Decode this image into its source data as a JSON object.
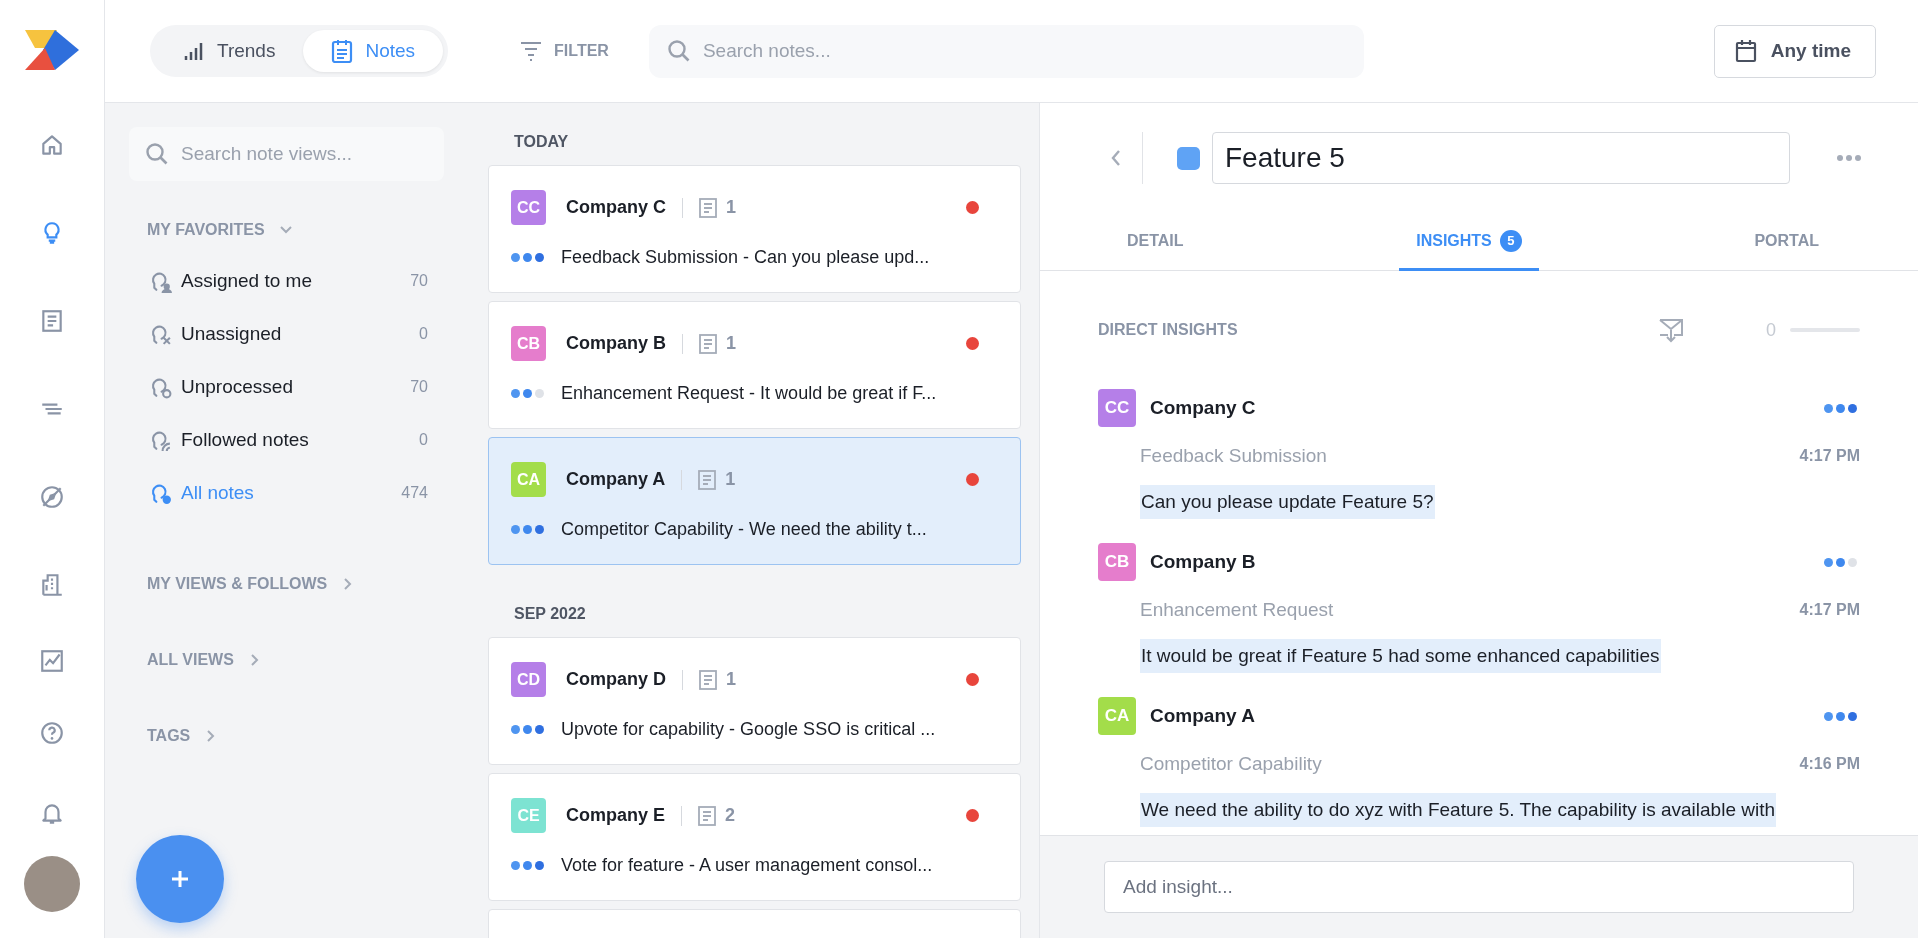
{
  "rail": {
    "items": [
      {
        "kind": "home",
        "selected": false
      },
      {
        "kind": "bulb",
        "selected": true
      },
      {
        "kind": "doc",
        "selected": false
      },
      {
        "kind": "lines",
        "selected": false
      },
      {
        "kind": "compass",
        "selected": false
      },
      {
        "kind": "building",
        "selected": false
      },
      {
        "kind": "chart",
        "selected": false
      },
      {
        "kind": "help",
        "selected": false
      },
      {
        "kind": "bell",
        "selected": false
      }
    ]
  },
  "top_bar": {
    "view_tabs": [
      {
        "kind": "trends",
        "label": "Trends",
        "selected": false
      },
      {
        "kind": "notes",
        "label": "Notes",
        "selected": true
      }
    ],
    "filter": "FILTER",
    "search": {
      "placeholder": "Search notes..."
    },
    "date_button": "Any time"
  },
  "sidebar": {
    "search": {
      "placeholder": "Search note views..."
    },
    "favorites": {
      "title": "MY FAVORITES",
      "expanded": true,
      "items": [
        {
          "kind": "assigned",
          "label": "Assigned to me",
          "count": "70",
          "selected": false
        },
        {
          "kind": "unassigned",
          "label": "Unassigned",
          "count": "0",
          "selected": false
        },
        {
          "kind": "unprocessed",
          "label": "Unprocessed",
          "count": "70",
          "selected": false
        },
        {
          "kind": "followed",
          "label": "Followed notes",
          "count": "0",
          "selected": false
        },
        {
          "kind": "all",
          "label": "All notes",
          "count": "474",
          "selected": true
        }
      ]
    },
    "sections": [
      {
        "title": "MY VIEWS & FOLLOWS",
        "expanded": false
      },
      {
        "title": "ALL VIEWS",
        "expanded": false
      },
      {
        "title": "TAGS",
        "expanded": false
      }
    ]
  },
  "notes": {
    "groups": [
      {
        "title": "TODAY",
        "notes": [
          {
            "initials": "CC",
            "company": "Company C",
            "color": "#b57fe8",
            "count": "1",
            "stars": 3,
            "summary": "Feedback Submission - Can you please upd...",
            "unprocessed": true,
            "selected": false
          },
          {
            "initials": "CB",
            "company": "Company B",
            "color": "#e57dcc",
            "count": "1",
            "stars": 2,
            "summary": "Enhancement Request - It would be great if F...",
            "unprocessed": true,
            "selected": false
          },
          {
            "initials": "CA",
            "company": "Company A",
            "color": "#a3dd4a",
            "count": "1",
            "stars": 3,
            "summary": "Competitor Capability - We need the ability t...",
            "unprocessed": true,
            "selected": true
          }
        ]
      },
      {
        "title": "SEP 2022",
        "notes": [
          {
            "initials": "CD",
            "company": "Company D",
            "color": "#b57fe8",
            "count": "1",
            "stars": 3,
            "summary": "Upvote for capability - Google SSO is critical ...",
            "unprocessed": true,
            "selected": false
          },
          {
            "initials": "CE",
            "company": "Company E",
            "color": "#7de3d2",
            "count": "2",
            "stars": 3,
            "summary": "Vote for feature - A user management consol...",
            "unprocessed": true,
            "selected": false
          }
        ]
      }
    ]
  },
  "detail": {
    "title": "Feature 5",
    "tabs": [
      {
        "label": "DETAIL",
        "selected": false
      },
      {
        "label": "INSIGHTS",
        "badge": "5",
        "selected": true
      },
      {
        "label": "PORTAL",
        "selected": false
      }
    ],
    "section_title": "DIRECT INSIGHTS",
    "counter": "0",
    "level": 0,
    "insights": [
      {
        "initials": "CC",
        "company": "Company C",
        "color": "#b57fe8",
        "stars": 3,
        "type": "Feedback Submission",
        "time": "4:17 PM",
        "text": "Can you please update Feature 5?"
      },
      {
        "initials": "CB",
        "company": "Company B",
        "color": "#e57dcc",
        "stars": 2,
        "type": "Enhancement Request",
        "time": "4:17 PM",
        "text": "It would be great if Feature 5 had some enhanced capabilities"
      },
      {
        "initials": "CA",
        "company": "Company A",
        "color": "#a3dd4a",
        "stars": 3,
        "type": "Competitor Capability",
        "time": "4:16 PM",
        "text": "We need the ability to do xyz with Feature 5. The capability is available with"
      }
    ],
    "add_insight": {
      "placeholder": "Add insight..."
    }
  }
}
